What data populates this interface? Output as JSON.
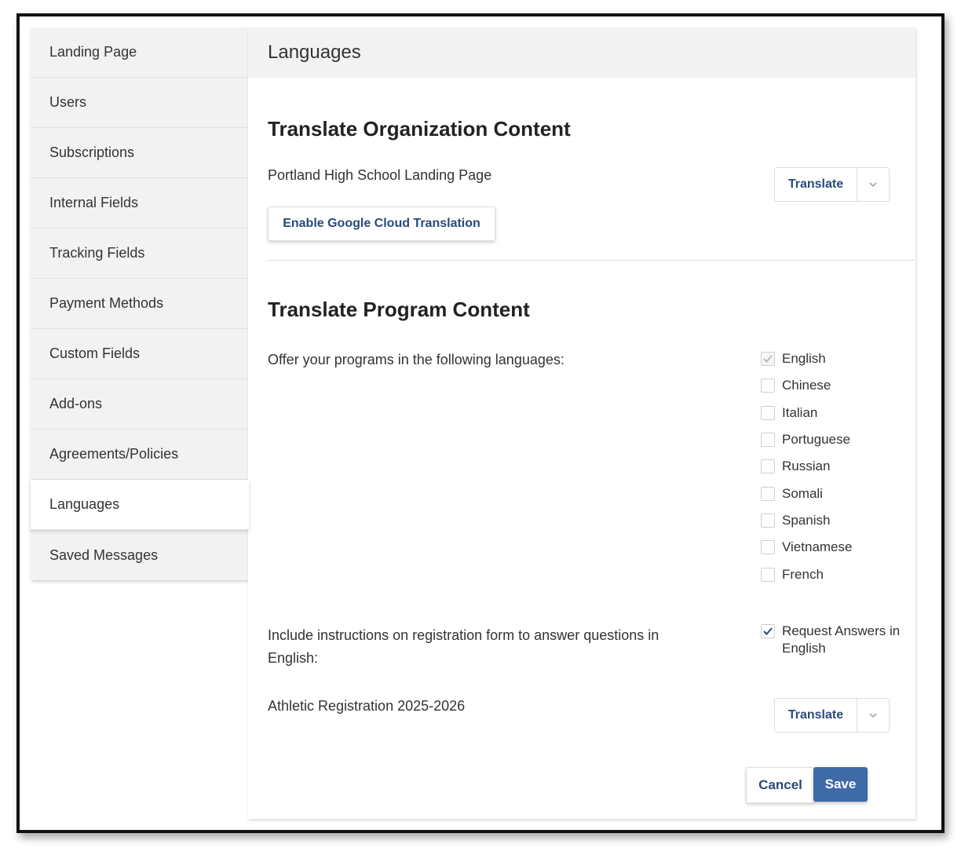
{
  "sidebar": {
    "items": [
      {
        "label": "Landing Page"
      },
      {
        "label": "Users"
      },
      {
        "label": "Subscriptions"
      },
      {
        "label": "Internal Fields"
      },
      {
        "label": "Tracking Fields"
      },
      {
        "label": "Payment Methods"
      },
      {
        "label": "Custom Fields"
      },
      {
        "label": "Add-ons"
      },
      {
        "label": "Agreements/Policies"
      },
      {
        "label": "Languages",
        "active": true
      },
      {
        "label": "Saved Messages"
      }
    ]
  },
  "main": {
    "title": "Languages",
    "org_section": {
      "heading": "Translate Organization Content",
      "item_label": "Portland High School Landing Page",
      "translate_label": "Translate",
      "enable_google_label": "Enable Google Cloud Translation"
    },
    "program_section": {
      "heading": "Translate Program Content",
      "offer_label": "Offer your programs in the following languages:",
      "languages": [
        {
          "label": "English",
          "checked": true,
          "disabled": true
        },
        {
          "label": "Chinese",
          "checked": false
        },
        {
          "label": "Italian",
          "checked": false
        },
        {
          "label": "Portuguese",
          "checked": false
        },
        {
          "label": "Russian",
          "checked": false
        },
        {
          "label": "Somali",
          "checked": false
        },
        {
          "label": "Spanish",
          "checked": false
        },
        {
          "label": "Vietnamese",
          "checked": false
        },
        {
          "label": "French",
          "checked": false
        }
      ],
      "instructions_label": "Include instructions on registration form to answer questions in English:",
      "request_answers_label_1": "Request Answers in",
      "request_answers_label_2": "English",
      "request_answers_checked": true,
      "program_label": "Athletic Registration 2025-2026",
      "translate_label": "Translate"
    },
    "footer": {
      "cancel_label": "Cancel",
      "save_label": "Save"
    }
  },
  "colors": {
    "accent": "#3f6aa8",
    "link_text": "#2a4a7a",
    "sidebar_bg": "#f2f2f2"
  }
}
